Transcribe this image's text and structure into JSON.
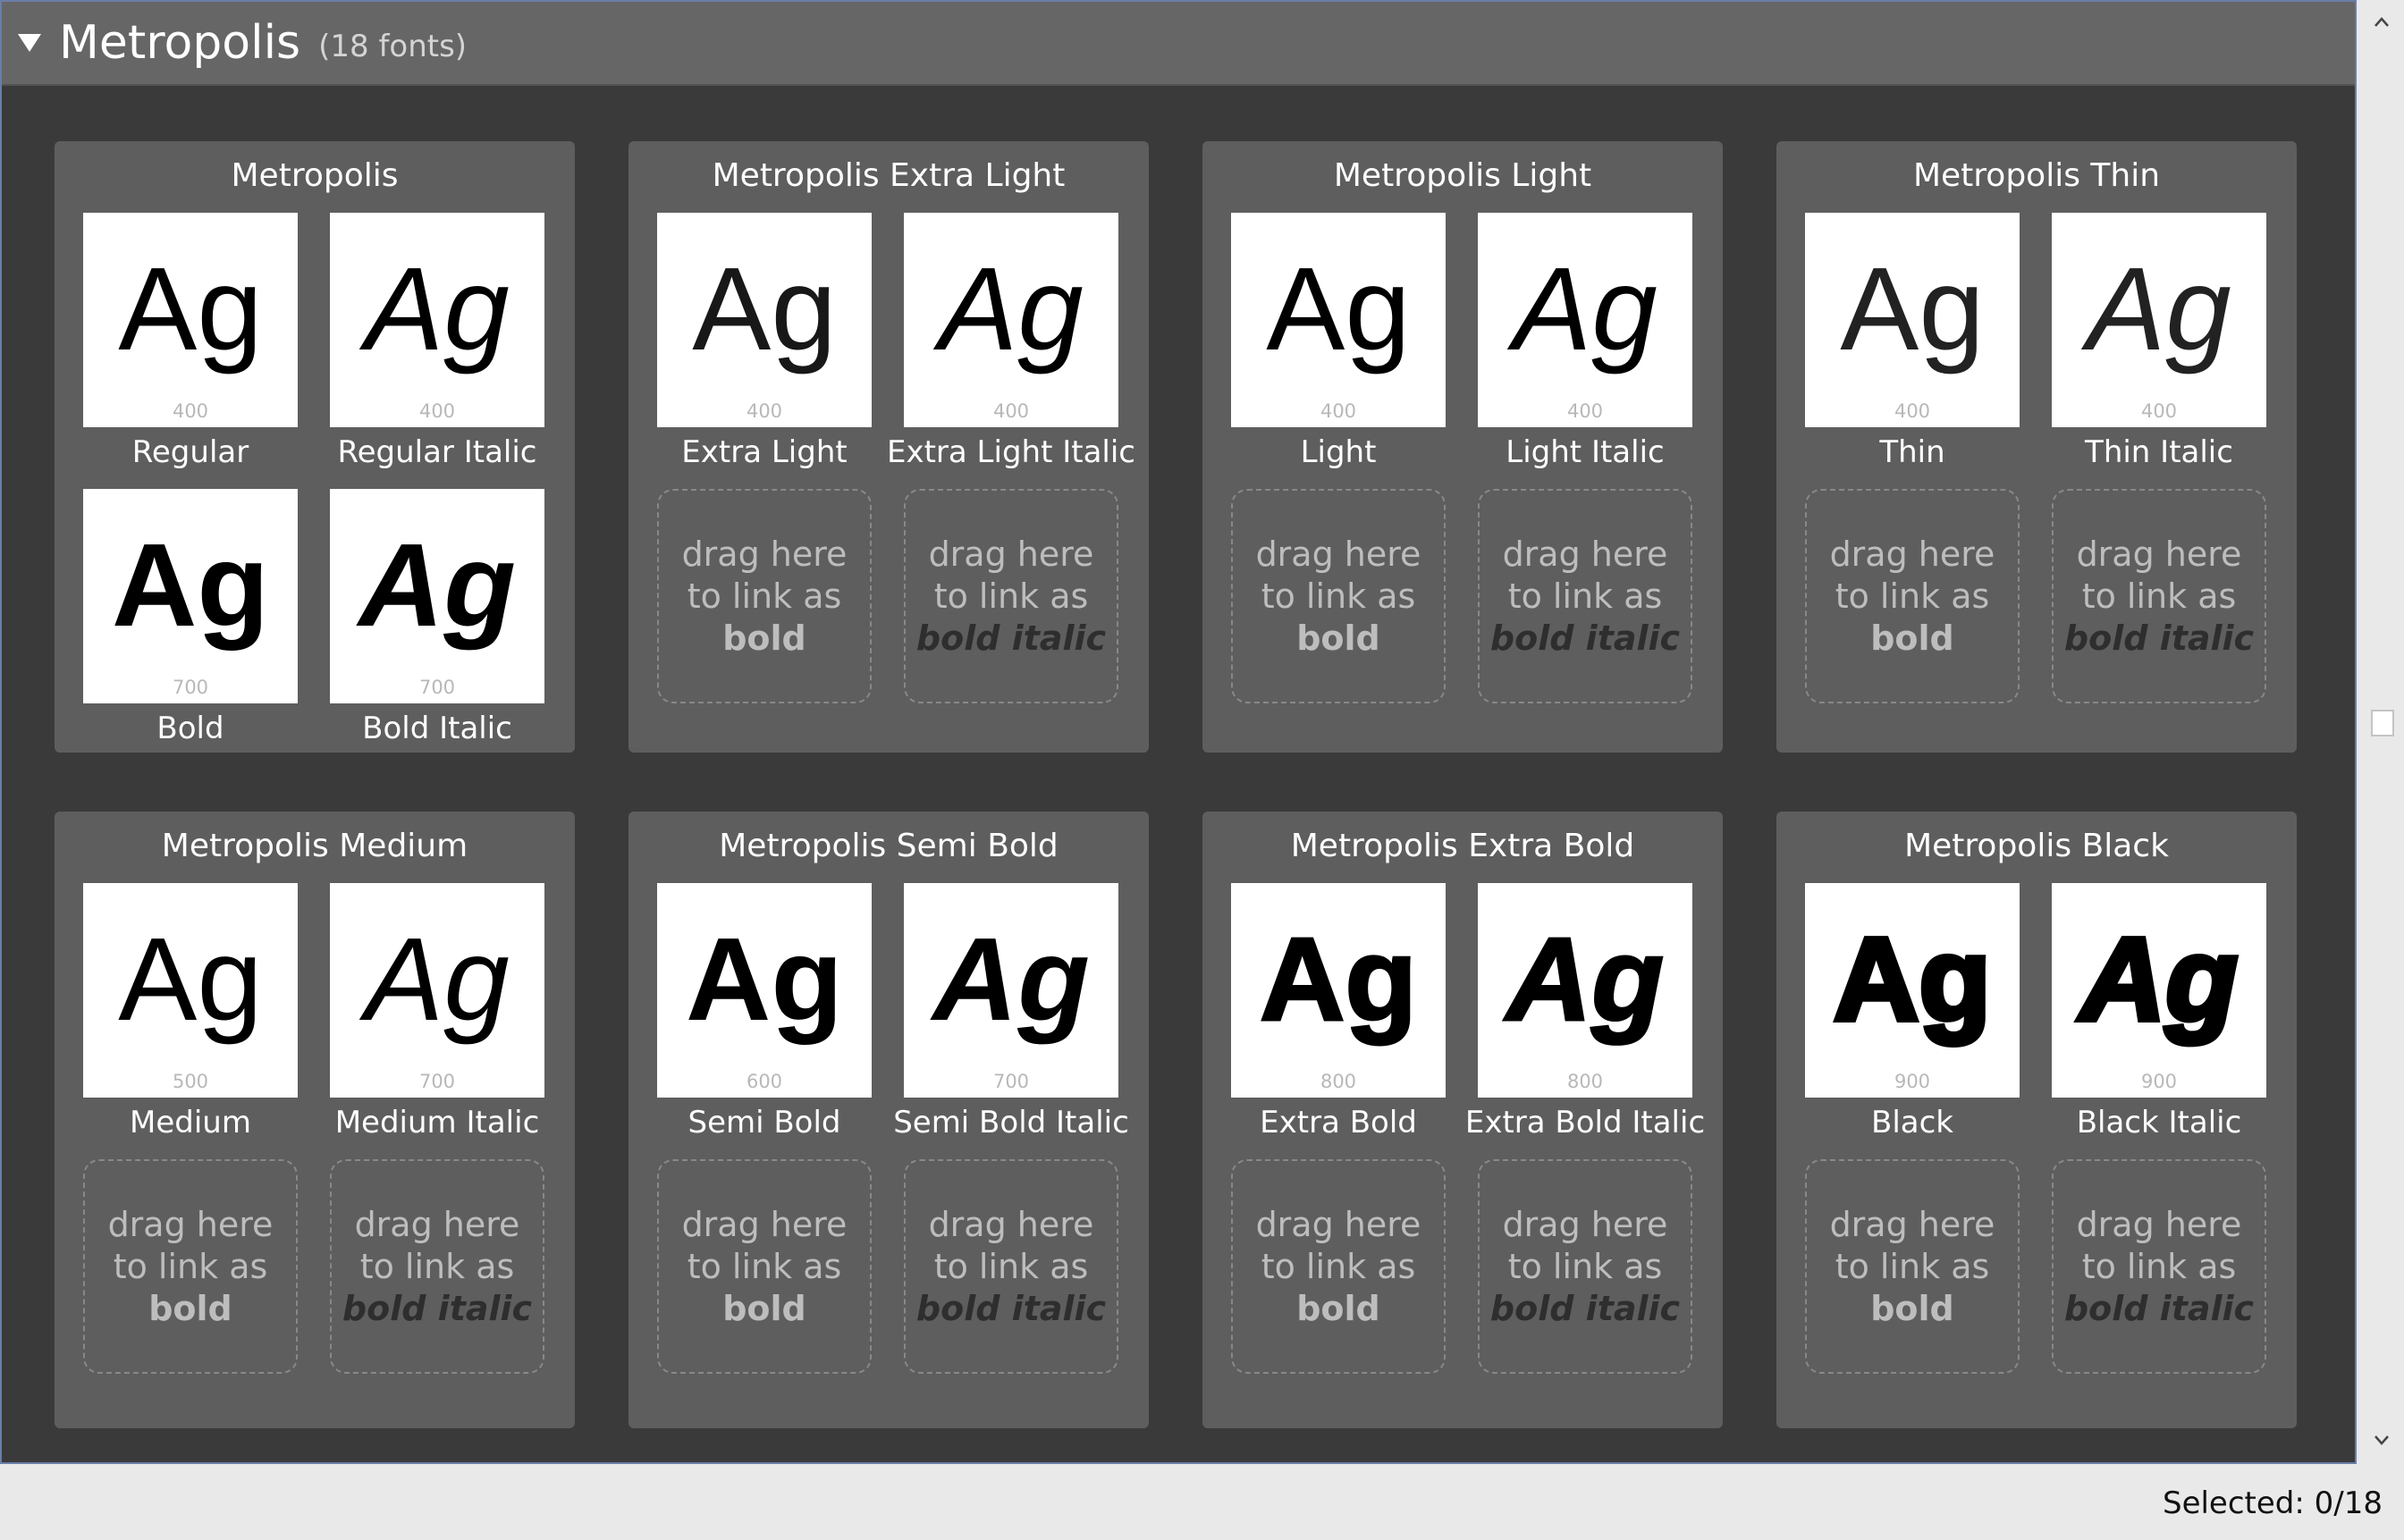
{
  "family": {
    "name": "Metropolis",
    "count": "(18 fonts)"
  },
  "drop": {
    "line1": "drag here",
    "line2": "to link as",
    "bold": "bold",
    "bold_italic": "bold italic"
  },
  "status": {
    "selected": "Selected: 0/18"
  },
  "cards": [
    {
      "title": "Metropolis",
      "regular": {
        "glyph": "Ag",
        "weight": "400",
        "label": "Regular"
      },
      "italic": {
        "glyph": "Ag",
        "weight": "400",
        "label": "Regular Italic"
      },
      "bold": {
        "glyph": "Ag",
        "weight": "700",
        "label": "Bold"
      },
      "bold_italic": {
        "glyph": "Ag",
        "weight": "700",
        "label": "Bold Italic"
      }
    },
    {
      "title": "Metropolis Extra Light",
      "regular": {
        "glyph": "Ag",
        "weight": "400",
        "label": "Extra Light"
      },
      "italic": {
        "glyph": "Ag",
        "weight": "400",
        "label": "Extra Light Italic"
      }
    },
    {
      "title": "Metropolis Light",
      "regular": {
        "glyph": "Ag",
        "weight": "400",
        "label": "Light"
      },
      "italic": {
        "glyph": "Ag",
        "weight": "400",
        "label": "Light Italic"
      }
    },
    {
      "title": "Metropolis Thin",
      "regular": {
        "glyph": "Ag",
        "weight": "400",
        "label": "Thin"
      },
      "italic": {
        "glyph": "Ag",
        "weight": "400",
        "label": "Thin Italic"
      }
    },
    {
      "title": "Metropolis Medium",
      "regular": {
        "glyph": "Ag",
        "weight": "500",
        "label": "Medium"
      },
      "italic": {
        "glyph": "Ag",
        "weight": "700",
        "label": "Medium Italic"
      }
    },
    {
      "title": "Metropolis Semi Bold",
      "regular": {
        "glyph": "Ag",
        "weight": "600",
        "label": "Semi Bold"
      },
      "italic": {
        "glyph": "Ag",
        "weight": "700",
        "label": "Semi Bold Italic"
      }
    },
    {
      "title": "Metropolis Extra Bold",
      "regular": {
        "glyph": "Ag",
        "weight": "800",
        "label": "Extra Bold"
      },
      "italic": {
        "glyph": "Ag",
        "weight": "800",
        "label": "Extra Bold Italic"
      }
    },
    {
      "title": "Metropolis Black",
      "regular": {
        "glyph": "Ag",
        "weight": "900",
        "label": "Black"
      },
      "italic": {
        "glyph": "Ag",
        "weight": "900",
        "label": "Black Italic"
      }
    }
  ]
}
